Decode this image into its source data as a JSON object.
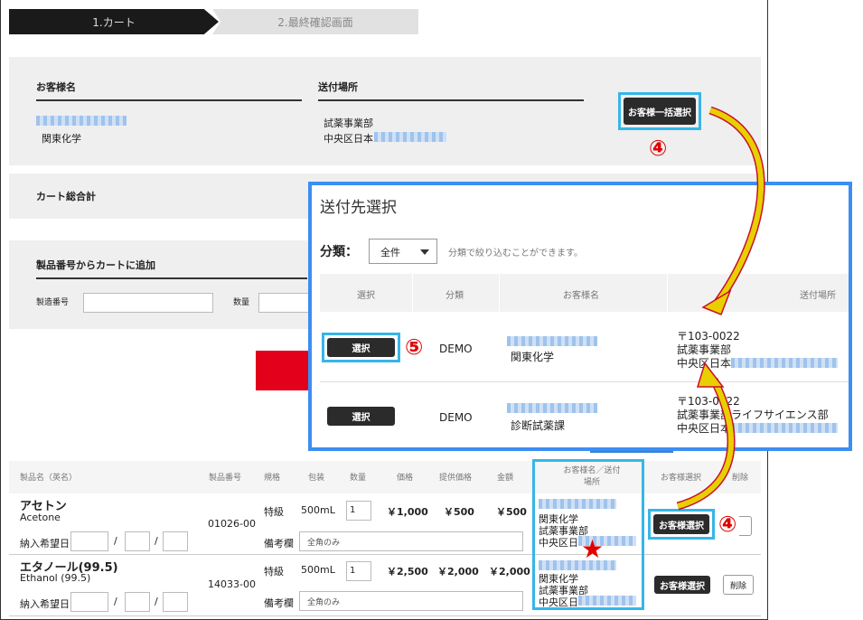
{
  "steps": [
    "1.カート",
    "2.最終確認画面"
  ],
  "customer": {
    "name_header": "お客様名",
    "ship_header": "送付場所",
    "company": "関東化学",
    "dept": "試薬事業部",
    "address": "中央区日本",
    "bulk_select_button": "お客様一括選択"
  },
  "cart_total_label": "カート総合計",
  "add_by_number": {
    "title": "製品番号からカートに追加",
    "serial_label": "製造番号",
    "qty_label": "数量"
  },
  "annotations": {
    "n4": "④",
    "n5": "⑤",
    "star": "★"
  },
  "modal": {
    "title": "送付先選択",
    "filter_label": "分類：",
    "filter_value": "全件",
    "filter_hint": "分類で絞り込むことができます。",
    "columns": [
      "選択",
      "分類",
      "お客様名",
      "送付場所"
    ],
    "rows": [
      {
        "button": "選択",
        "category": "DEMO",
        "customer": "関東化学",
        "postal": "〒103-0022",
        "dept": "試薬事業部",
        "address": "中央区日本"
      },
      {
        "button": "選択",
        "category": "DEMO",
        "customer": "診断試薬課",
        "postal": "〒103-0022",
        "dept": "試薬事業部ライフサイエンス部",
        "address": "中央区日本"
      }
    ]
  },
  "table": {
    "headers": [
      "製品名（英名）",
      "製品番号",
      "規格",
      "包装",
      "数量",
      "価格",
      "提供価格",
      "金額",
      "お客様名／送付場所",
      "お客様選択",
      "削除"
    ],
    "delivery_label": "納入希望日",
    "remarks_label": "備考欄",
    "remarks_placeholder": "全角のみ",
    "customer_select_button": "お客様選択",
    "delete_button": "削除",
    "items": [
      {
        "name": "アセトン",
        "name_en": "Acetone",
        "number": "01026-00",
        "grade": "特級",
        "pack": "500mL",
        "qty": "1",
        "price": "￥1,000",
        "offer": "￥500",
        "amount": "￥500",
        "company": "関東化学",
        "dept": "試薬事業部",
        "address": "中央区日"
      },
      {
        "name": "エタノール(99.5)",
        "name_en": "Ethanol (99.5)",
        "number": "14033-00",
        "grade": "特級",
        "pack": "500mL",
        "qty": "1",
        "price": "￥2,500",
        "offer": "￥2,000",
        "amount": "￥2,000",
        "company": "関東化学",
        "dept": "試薬事業部",
        "address": "中央区日"
      }
    ]
  },
  "colors": {
    "highlight": "#36b6e8",
    "annotation": "#e00000",
    "arrow": "#e8d000",
    "modal_border": "#3c8ef2"
  }
}
